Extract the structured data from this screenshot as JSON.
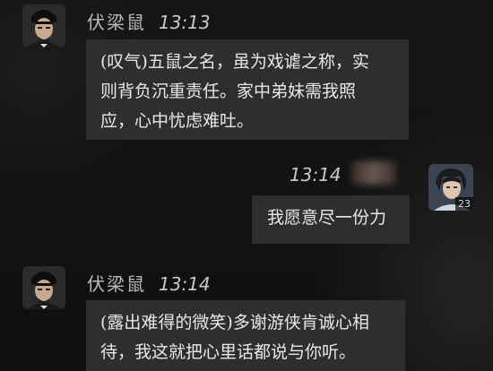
{
  "messages": [
    {
      "sender": "伏梁鼠",
      "time": "13:13",
      "text": "(叹气)五鼠之名，虽为戏谑之称，实\n则背负沉重责任。家中弟妹需我照\n应，心中忧虑难吐。"
    },
    {
      "time": "13:14",
      "player_level": "23",
      "text": "我愿意尽一份力"
    },
    {
      "sender": "伏梁鼠",
      "time": "13:14",
      "text": "(露出难得的微笑)多谢游侠肯诚心相\n待，我这就把心里话都说与你听。"
    }
  ]
}
